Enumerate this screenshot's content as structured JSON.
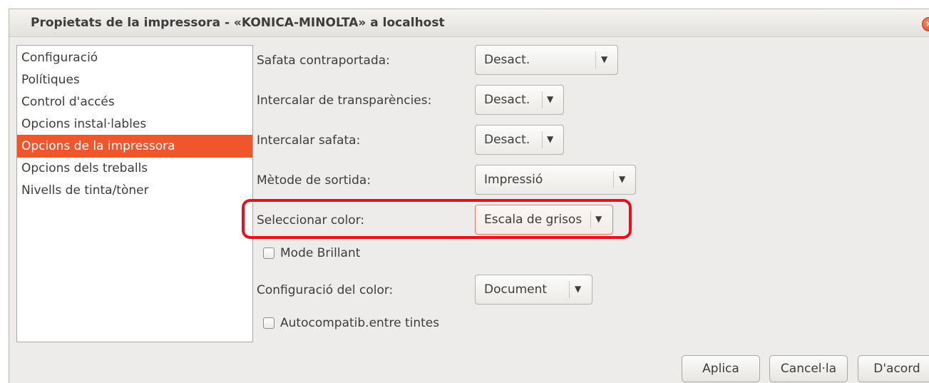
{
  "window": {
    "title": "Propietats de la impressora - «KONICA-MINOLTA» a localhost",
    "close_glyph": "×"
  },
  "sidebar": {
    "items": [
      {
        "label": "Configuració"
      },
      {
        "label": "Polítiques"
      },
      {
        "label": "Control d'accés"
      },
      {
        "label": "Opcions instal·lables"
      },
      {
        "label": "Opcions de la impressora",
        "selected": true
      },
      {
        "label": "Opcions dels treballs"
      },
      {
        "label": "Nivells de tinta/tòner"
      }
    ]
  },
  "options": {
    "safata_contraportada": {
      "label": "Safata contraportada:",
      "value": "Desact."
    },
    "intercalar_transparencies": {
      "label": "Intercalar de transparències:",
      "value": "Desact."
    },
    "intercalar_safata": {
      "label": "Intercalar safata:",
      "value": "Desact."
    },
    "metode_sortida": {
      "label": "Mètode de sortida:",
      "value": "Impressió"
    },
    "seleccionar_color": {
      "label": "Seleccionar color:",
      "value": "Escala de grisos"
    },
    "mode_brillant": {
      "label": "Mode Brillant",
      "checked": false
    },
    "configuracio_color": {
      "label": "Configuració del color:",
      "value": "Document"
    },
    "autocompatib": {
      "label": "Autocompatib.entre tintes",
      "checked": false
    }
  },
  "combo_arrow_glyph": "▼",
  "buttons": {
    "apply": "Aplica",
    "cancel": "Cancel·la",
    "ok": "D'acord"
  },
  "colors": {
    "accent": "#f0562b",
    "highlight": "#e8111b"
  }
}
